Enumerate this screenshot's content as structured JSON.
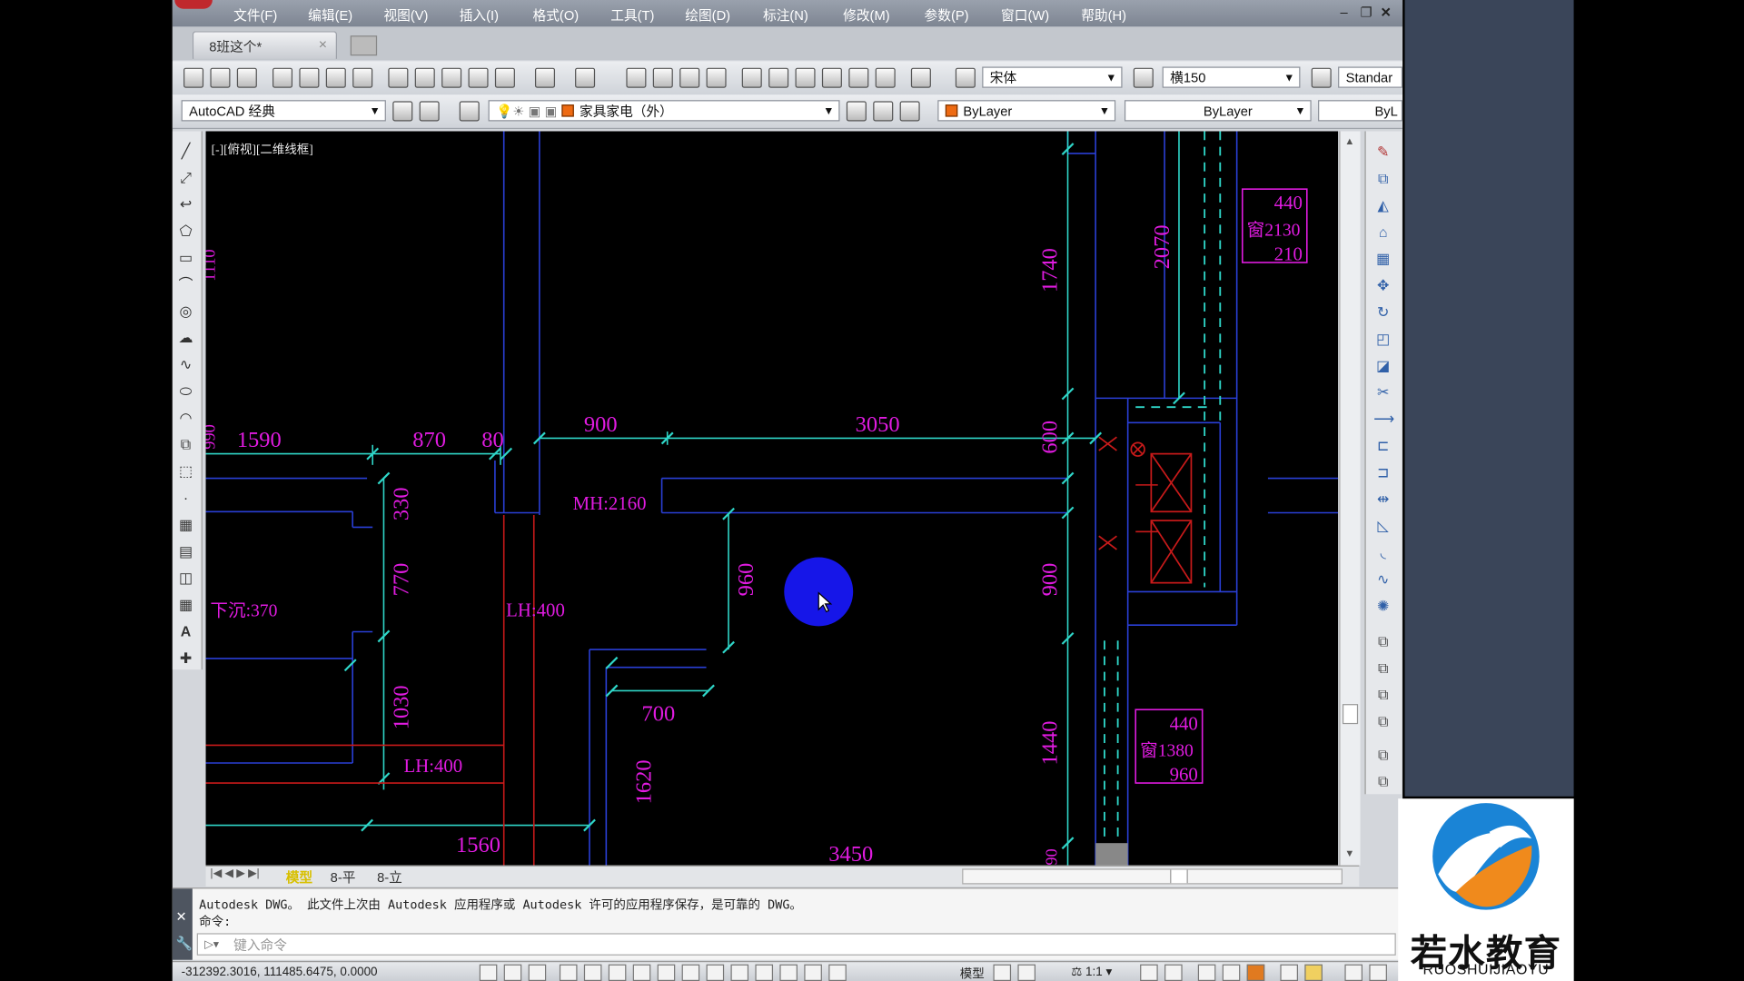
{
  "menu": [
    "文件(F)",
    "编辑(E)",
    "视图(V)",
    "插入(I)",
    "格式(O)",
    "工具(T)",
    "绘图(D)",
    "标注(N)",
    "修改(M)",
    "参数(P)",
    "窗口(W)",
    "帮助(H)"
  ],
  "doc_tab": {
    "label": "8班这个*",
    "close": "×"
  },
  "toolbar": {
    "textstyle_font": "宋体",
    "dimstyle": "横150",
    "tablestyle": "Standar",
    "workspace": "AutoCAD 经典",
    "layer": "家具家电（外）",
    "color": "ByLayer",
    "linetype": "ByLayer",
    "lineweight": "ByL"
  },
  "viewport_label": "[-][俯视][二维线框]",
  "dimensions": {
    "d1590": "1590",
    "d870": "870",
    "d80": "80",
    "d900a": "900",
    "d3050": "3050",
    "d600": "600",
    "d330": "330",
    "d770": "770",
    "d1030": "1030",
    "d960": "960",
    "d700": "700",
    "d1620": "1620",
    "d1560": "1560",
    "d3450": "3450",
    "d1740": "1740",
    "d2070": "2070",
    "d900b": "900",
    "d1440": "1440",
    "d1110": "1110",
    "d990": "990",
    "d90": "90"
  },
  "annotations": {
    "mh": "MH:2160",
    "xiachen": "下沉:370",
    "lh1": "LH:400",
    "lh2": "LH:400"
  },
  "window_tags": [
    {
      "l1": "440",
      "l2": "窗2130",
      "l3": "210"
    },
    {
      "l1": "440",
      "l2": "窗1380",
      "l3": "960"
    }
  ],
  "layout_tabs": [
    "模型",
    "8-平",
    "8-立"
  ],
  "command": {
    "line1": "Autodesk DWG。  此文件上次由 Autodesk 应用程序或 Autodesk 许可的应用程序保存，是可靠的 DWG。",
    "line2": "命令:",
    "placeholder": "键入命令"
  },
  "status": {
    "coords": "-312392.3016, 111485.6475, 0.0000",
    "model": "模型",
    "scale": "1:1"
  },
  "logo": {
    "cn": "若水教育",
    "en": "RUOSHUIJIAOYU"
  },
  "colors": {
    "dim_text": "#e01be0",
    "cyan_line": "#2fd6c8",
    "blue_wall": "#2a3fd6",
    "red_line": "#c81a1a",
    "cursor": "#1616e8"
  }
}
